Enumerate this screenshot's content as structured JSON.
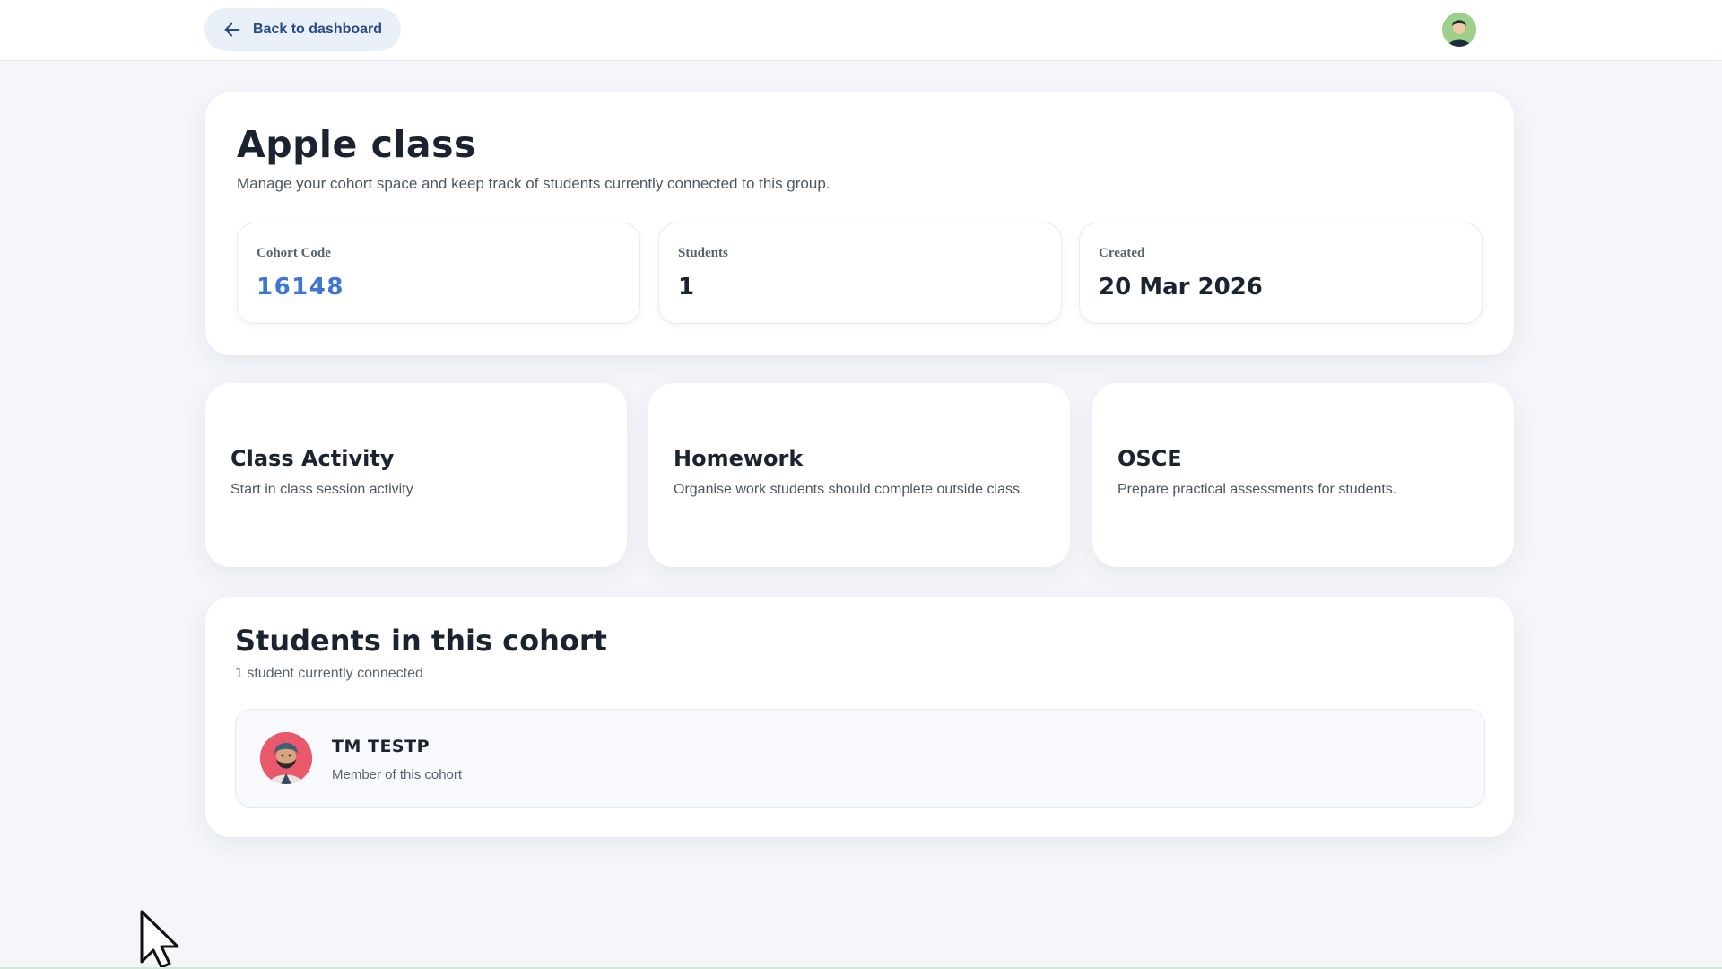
{
  "topbar": {
    "back_label": "Back to dashboard",
    "back_icon": "arrow-left-icon",
    "avatar_icon": "user-avatar-icon"
  },
  "hero": {
    "title": "Apple class",
    "subtitle": "Manage your cohort space and keep track of students currently connected to this group.",
    "stats": [
      {
        "label": "Cohort Code",
        "value": "16148"
      },
      {
        "label": "Students",
        "value": "1"
      },
      {
        "label": "Created",
        "value": "20 Mar 2026"
      }
    ]
  },
  "features": [
    {
      "title": "Class Activity",
      "desc": "Start in class session activity"
    },
    {
      "title": "Homework",
      "desc": "Organise work students should complete outside class."
    },
    {
      "title": "OSCE",
      "desc": "Prepare practical assessments for students."
    }
  ],
  "students": {
    "title": "Students in this cohort",
    "subtitle": "1 student currently connected",
    "list": [
      {
        "name": "TM TESTP",
        "role": "Member of this cohort"
      }
    ]
  },
  "colors": {
    "accent": "#3f76d4",
    "back_button_bg": "#eaf0f8",
    "page_bg": "#f4f6fa"
  }
}
